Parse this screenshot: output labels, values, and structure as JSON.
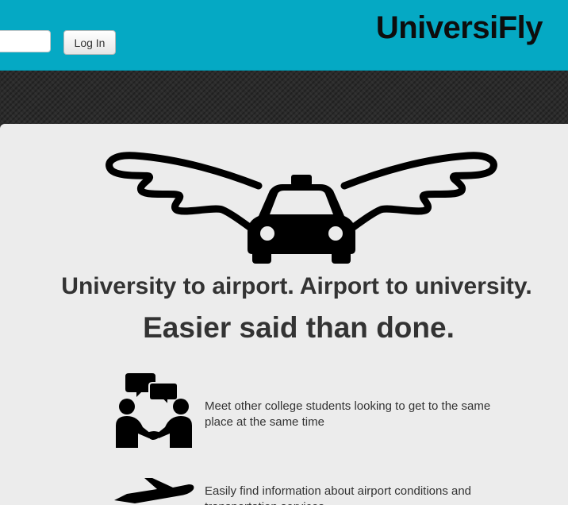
{
  "header": {
    "login_button_label": "Log In",
    "brand_name": "UniversiFly",
    "colors": {
      "header_bg": "#05a9c4",
      "brand_text": "#0d0d0d"
    }
  },
  "hero": {
    "logo_icon": "winged-taxi-icon",
    "headline": "University to airport. Airport to university.",
    "subheadline": "Easier said than done."
  },
  "features": [
    {
      "icon": "students-meeting-icon",
      "text": "Meet other college students looking to get to the same place at the same time"
    },
    {
      "icon": "airplane-icon",
      "text": "Easily find information about airport conditions and transportation services"
    }
  ]
}
